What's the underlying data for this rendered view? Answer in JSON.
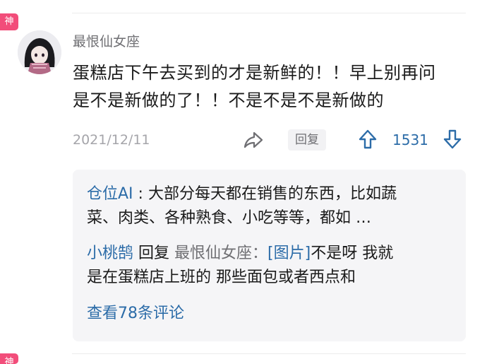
{
  "badges": {
    "shen": "神"
  },
  "comment": {
    "username": "最恨仙女座",
    "content_lines": [
      "蛋糕店下午去买到的才是新鲜的！！早上别再问",
      "是不是新做的了！！不是不是不是新做的"
    ],
    "date": "2021/12/11",
    "reply_label": "回复",
    "vote_count": "1531"
  },
  "replies": [
    {
      "author": "仓位AI",
      "separator": " : ",
      "text_lines": [
        "大部分每天都在销售的东西，比如蔬",
        "菜、肉类、各种熟食、小吃等等，都如 …"
      ]
    },
    {
      "author": "小桃鹄",
      "reply_word": " 回复 ",
      "reply_to": "最恨仙女座",
      "separator": "：",
      "image_tag": "[图片]",
      "text_line1": "不是呀 我就",
      "text_line2": "是在蛋糕店上班的 那些面包或者西点和"
    }
  ],
  "view_more": "查看78条评论",
  "colors": {
    "accent_blue": "#2c6ca8",
    "badge_pink": "#f24d7a",
    "sub_bg": "#f5f5f7"
  },
  "icons": [
    "share-icon",
    "upvote-arrow-icon",
    "downvote-arrow-icon"
  ]
}
